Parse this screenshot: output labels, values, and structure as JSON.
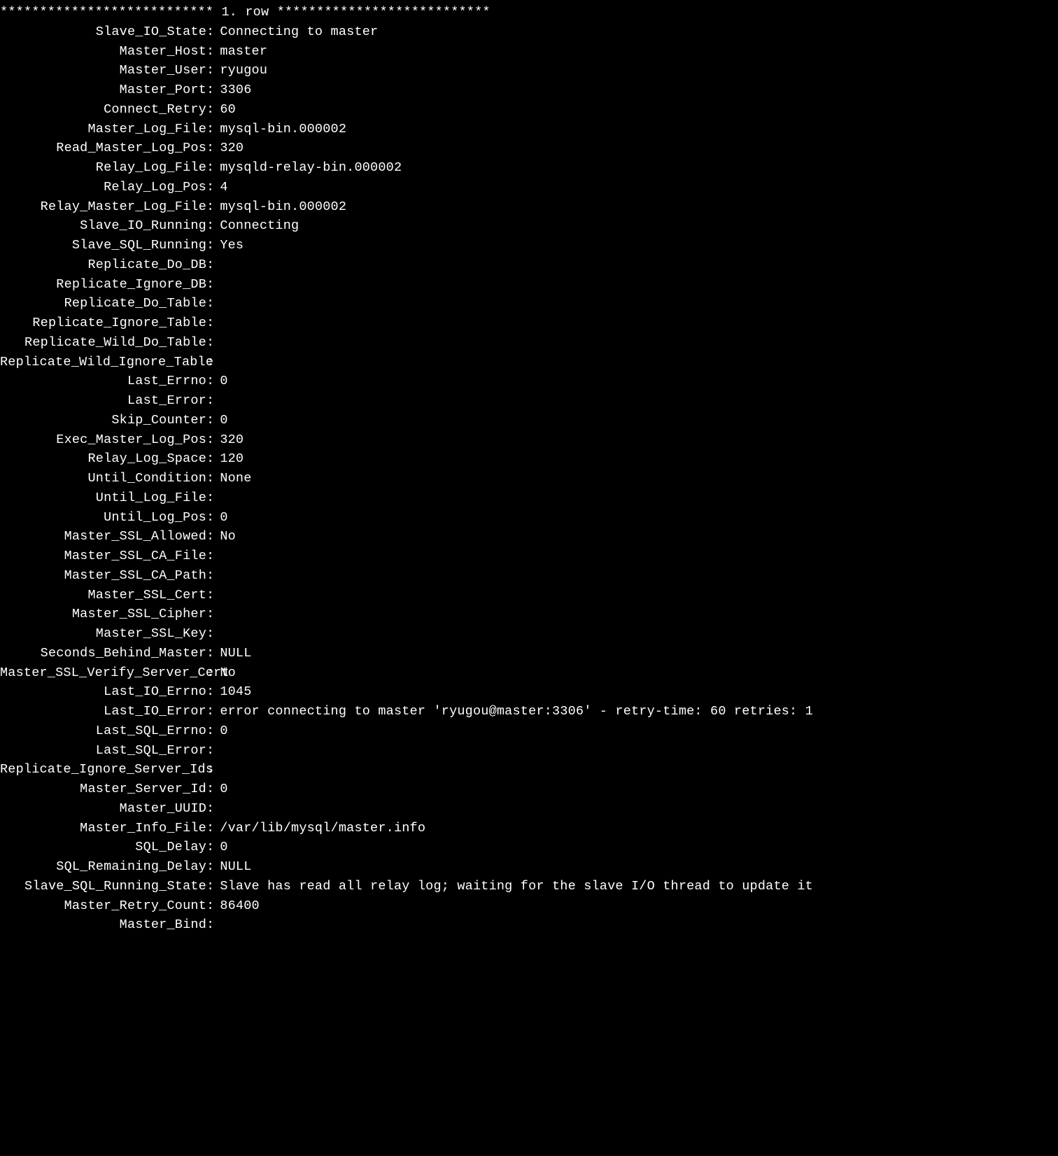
{
  "header": "*************************** 1. row ***************************",
  "rows": [
    {
      "label": "Slave_IO_State",
      "value": "Connecting to master"
    },
    {
      "label": "Master_Host",
      "value": "master"
    },
    {
      "label": "Master_User",
      "value": "ryugou"
    },
    {
      "label": "Master_Port",
      "value": "3306"
    },
    {
      "label": "Connect_Retry",
      "value": "60"
    },
    {
      "label": "Master_Log_File",
      "value": "mysql-bin.000002"
    },
    {
      "label": "Read_Master_Log_Pos",
      "value": "320"
    },
    {
      "label": "Relay_Log_File",
      "value": "mysqld-relay-bin.000002"
    },
    {
      "label": "Relay_Log_Pos",
      "value": "4"
    },
    {
      "label": "Relay_Master_Log_File",
      "value": "mysql-bin.000002"
    },
    {
      "label": "Slave_IO_Running",
      "value": "Connecting"
    },
    {
      "label": "Slave_SQL_Running",
      "value": "Yes"
    },
    {
      "label": "Replicate_Do_DB",
      "value": ""
    },
    {
      "label": "Replicate_Ignore_DB",
      "value": ""
    },
    {
      "label": "Replicate_Do_Table",
      "value": ""
    },
    {
      "label": "Replicate_Ignore_Table",
      "value": ""
    },
    {
      "label": "Replicate_Wild_Do_Table",
      "value": ""
    },
    {
      "label": "Replicate_Wild_Ignore_Table",
      "value": ""
    },
    {
      "label": "Last_Errno",
      "value": "0"
    },
    {
      "label": "Last_Error",
      "value": ""
    },
    {
      "label": "Skip_Counter",
      "value": "0"
    },
    {
      "label": "Exec_Master_Log_Pos",
      "value": "320"
    },
    {
      "label": "Relay_Log_Space",
      "value": "120"
    },
    {
      "label": "Until_Condition",
      "value": "None"
    },
    {
      "label": "Until_Log_File",
      "value": ""
    },
    {
      "label": "Until_Log_Pos",
      "value": "0"
    },
    {
      "label": "Master_SSL_Allowed",
      "value": "No"
    },
    {
      "label": "Master_SSL_CA_File",
      "value": ""
    },
    {
      "label": "Master_SSL_CA_Path",
      "value": ""
    },
    {
      "label": "Master_SSL_Cert",
      "value": ""
    },
    {
      "label": "Master_SSL_Cipher",
      "value": ""
    },
    {
      "label": "Master_SSL_Key",
      "value": ""
    },
    {
      "label": "Seconds_Behind_Master",
      "value": "NULL"
    },
    {
      "label": "Master_SSL_Verify_Server_Cert",
      "value": "No"
    },
    {
      "label": "Last_IO_Errno",
      "value": "1045"
    },
    {
      "label": "Last_IO_Error",
      "value": "error connecting to master 'ryugou@master:3306' - retry-time: 60  retries: 1"
    },
    {
      "label": "Last_SQL_Errno",
      "value": "0"
    },
    {
      "label": "Last_SQL_Error",
      "value": ""
    },
    {
      "label": "Replicate_Ignore_Server_Ids",
      "value": ""
    },
    {
      "label": "Master_Server_Id",
      "value": "0"
    },
    {
      "label": "Master_UUID",
      "value": ""
    },
    {
      "label": "Master_Info_File",
      "value": "/var/lib/mysql/master.info"
    },
    {
      "label": "SQL_Delay",
      "value": "0"
    },
    {
      "label": "SQL_Remaining_Delay",
      "value": "NULL"
    },
    {
      "label": "Slave_SQL_Running_State",
      "value": "Slave has read all relay log; waiting for the slave I/O thread to update it"
    },
    {
      "label": "Master_Retry_Count",
      "value": "86400"
    },
    {
      "label": "Master_Bind",
      "value": ""
    }
  ]
}
